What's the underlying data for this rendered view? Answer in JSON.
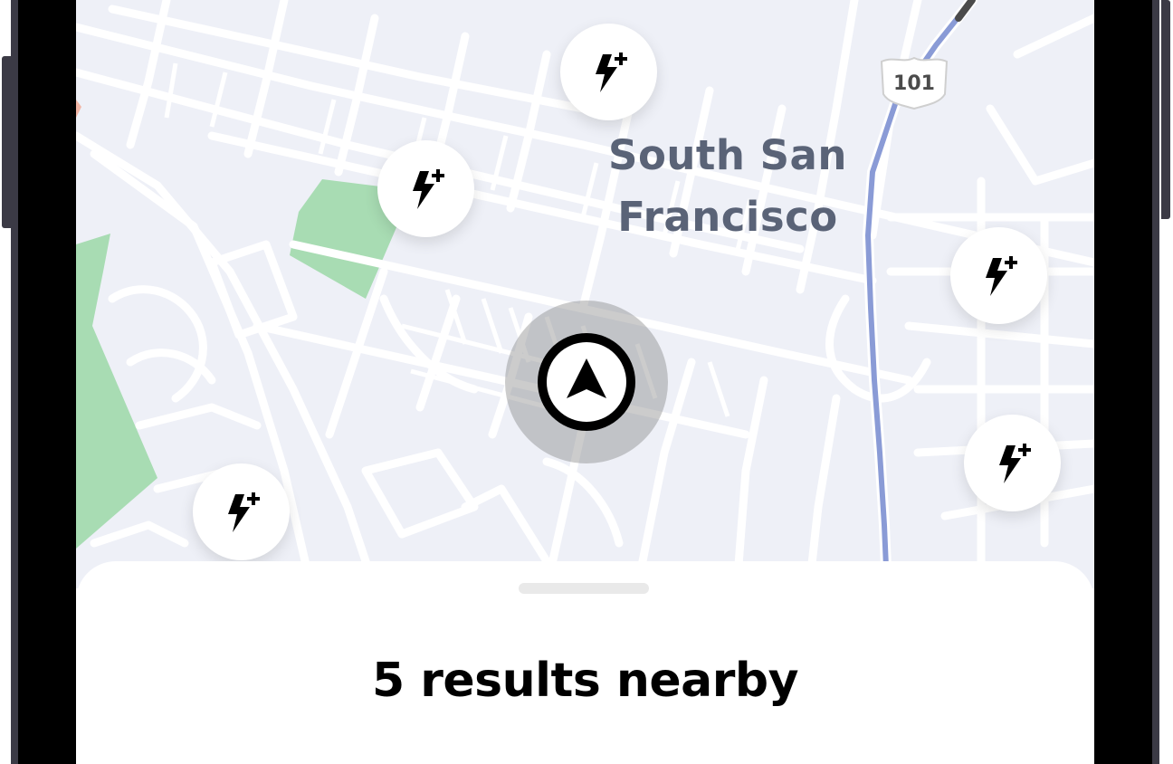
{
  "map": {
    "city_label_line1": "South San",
    "city_label_line2": "Francisco",
    "highway_shield": "101",
    "colors": {
      "background": "#eef0f7",
      "road": "#ffffff",
      "highway": "#8a9bd6",
      "park": "#a8dcb3",
      "label": "#5a6377"
    },
    "charger_icon": "bolt-plus-icon",
    "location_icon": "navigation-arrow-icon"
  },
  "sheet": {
    "title": "5 results nearby"
  }
}
